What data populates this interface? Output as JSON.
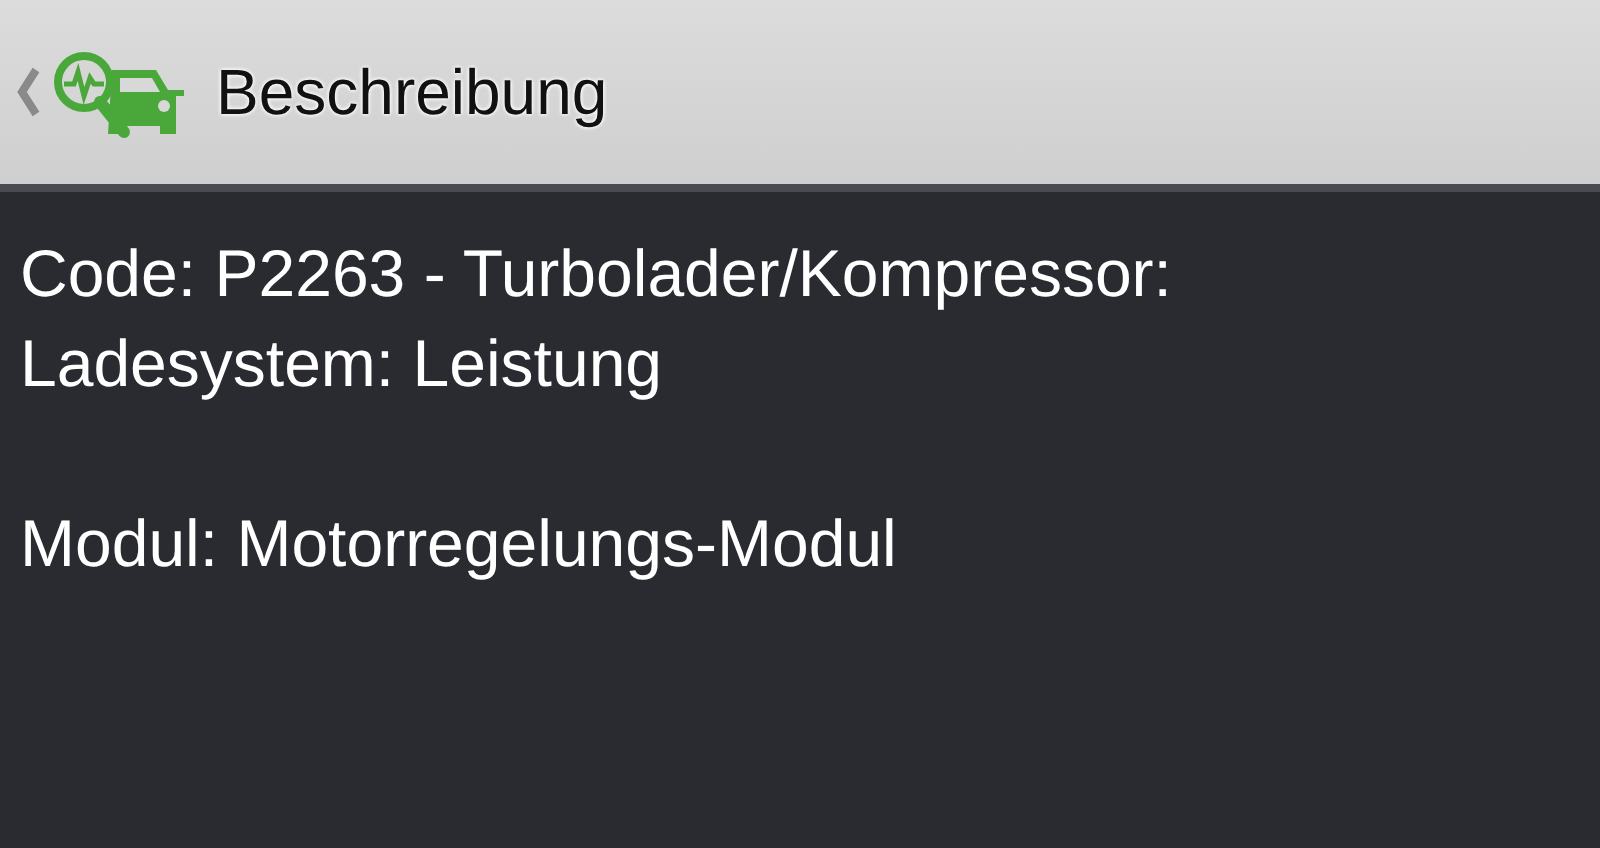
{
  "header": {
    "title": "Beschreibung"
  },
  "details": [
    {
      "text": "Code: P2263 - Turbolader/Kompressor: Ladesystem: Leistung"
    },
    {
      "text": "Modul: Motorregelungs-Modul"
    }
  ]
}
